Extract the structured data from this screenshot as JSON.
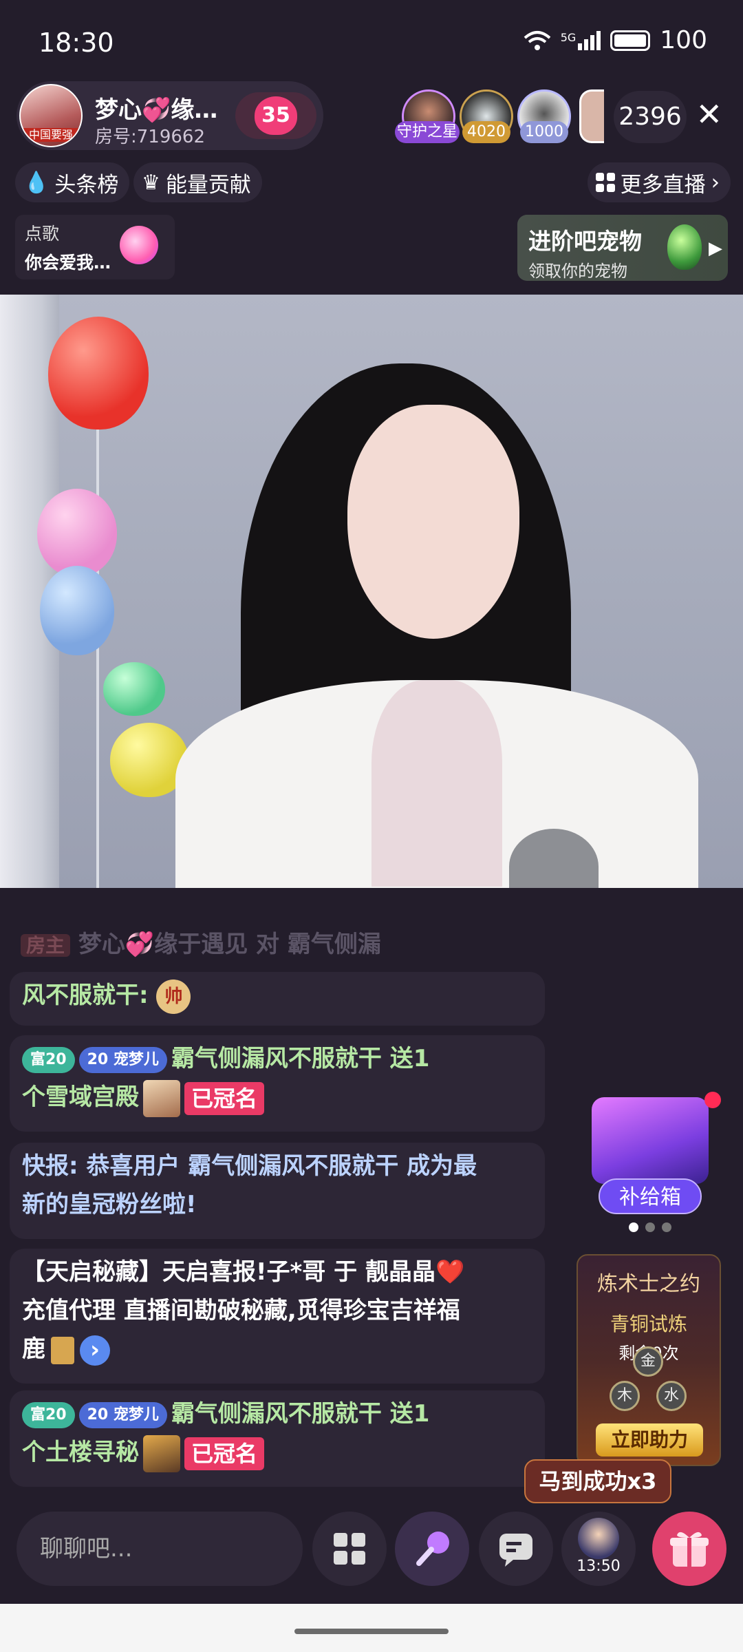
{
  "status_bar": {
    "time": "18:30",
    "network": "5G",
    "battery": "100"
  },
  "host": {
    "name": "梦心💞缘…",
    "room_id": "房号:719662",
    "avatar_tag": "中国要强",
    "level": "35"
  },
  "viewers": {
    "badges": [
      "守护之星",
      "4020",
      "1000"
    ],
    "count": "2396"
  },
  "chips": {
    "headline": "头条榜",
    "energy": "能量贡献",
    "more_live": "更多直播"
  },
  "song": {
    "title": "点歌",
    "name": "你会爱我…"
  },
  "pet": {
    "title": "进阶吧宠物",
    "subtitle": "领取你的宠物"
  },
  "chat": {
    "fading_line": {
      "role": "房主",
      "user": "梦心💞缘于遇见",
      "text": "对 霸气侧漏"
    },
    "msg1": {
      "text": "风不服就干:",
      "badge": "帅"
    },
    "msg2": {
      "fu": "富20",
      "fan_level": "20",
      "fan_name": "宠梦儿",
      "line1": "霸气侧漏风不服就干 送1",
      "line2": "个雪域宫殿",
      "named": "已冠名"
    },
    "msg3": {
      "line1": "快报: 恭喜用户 霸气侧漏风不服就干 成为最",
      "line2": "新的皇冠粉丝啦!"
    },
    "msg4": {
      "line1": "【天启秘藏】天启喜报!子*哥 于 靓晶晶❤️",
      "line2": "充值代理 直播间勘破秘藏,觅得珍宝吉祥福",
      "line3": "鹿",
      "arrow": "›"
    },
    "msg5": {
      "fu": "富20",
      "fan_level": "20",
      "fan_name": "宠梦儿",
      "line1": "霸气侧漏风不服就干 送1",
      "line2": "个土楼寻秘",
      "named": "已冠名"
    }
  },
  "widgets": {
    "supply": "补给箱",
    "trial_title": "炼术士之约",
    "trial_stage": "青铜试炼",
    "trial_left": "剩余0次",
    "runes": [
      "金",
      "木",
      "水"
    ],
    "help": "立即助力",
    "toast": "马到成功x3",
    "timer": "13:50"
  },
  "bottom": {
    "placeholder": "聊聊吧..."
  },
  "colors": {
    "bg": "#231d2b",
    "accent_pink": "#ea3a66",
    "green_text": "#b6e8a4"
  },
  "icons": [
    "wifi-icon",
    "signal-icon",
    "battery-icon",
    "close-icon",
    "drop-icon",
    "crown-icon",
    "grid-icon",
    "chevron-right-icon",
    "microphone-icon",
    "chat-icon",
    "gift-icon"
  ]
}
